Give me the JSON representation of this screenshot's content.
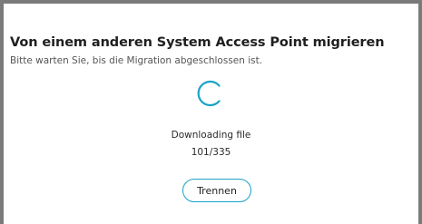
{
  "dialog": {
    "title": "Von einem anderen System Access Point migrieren",
    "subtitle": "Bitte warten Sie, bis die Migration abgeschlossen ist.",
    "status_text": "Downloading file",
    "progress_text": "101/335",
    "disconnect_label": "Trennen"
  },
  "icons": {
    "spinner": "loading-spinner-icon"
  },
  "colors": {
    "accent": "#1aa3c7",
    "backdrop": "#7b7b7b",
    "surface": "#ffffff"
  }
}
